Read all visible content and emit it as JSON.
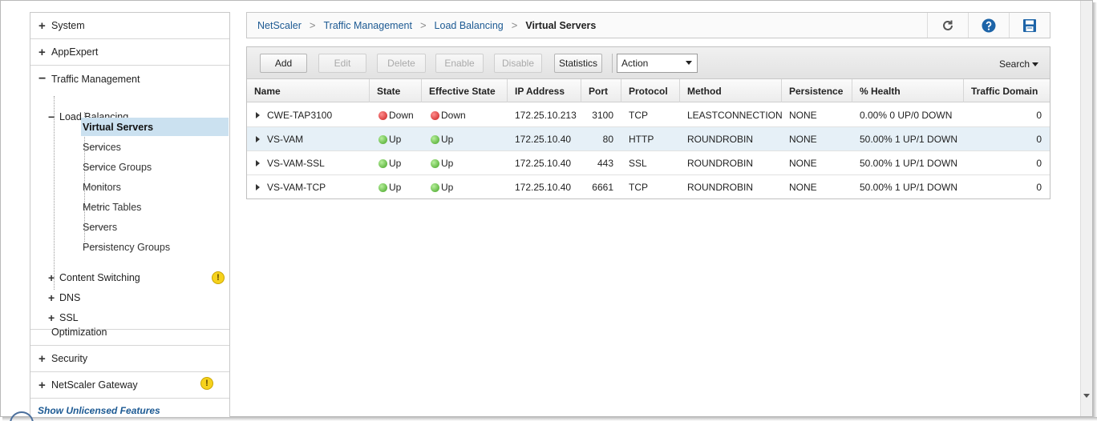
{
  "nav": {
    "top_items": [
      {
        "label": "System",
        "expander": "+"
      },
      {
        "label": "AppExpert",
        "expander": "+"
      },
      {
        "label": "Traffic Management",
        "expander": "−"
      }
    ],
    "tree": {
      "load_balancing": {
        "label": "Load Balancing",
        "expander": "−"
      },
      "lb_children": [
        "Virtual Servers",
        "Services",
        "Service Groups",
        "Monitors",
        "Metric Tables",
        "Servers",
        "Persistency Groups"
      ],
      "active_child": "Virtual Servers",
      "content_switching": {
        "label": "Content Switching",
        "expander": "+",
        "warning": "!"
      },
      "dns": {
        "label": "DNS",
        "expander": "+"
      },
      "ssl": {
        "label": "SSL",
        "expander": "+"
      }
    },
    "bottom_items": [
      {
        "label": "Optimization",
        "expander": ""
      },
      {
        "label": "Security",
        "expander": "+"
      },
      {
        "label": "NetScaler Gateway",
        "expander": "+",
        "warning": "!"
      }
    ],
    "unlicensed_link": "Show Unlicensed Features"
  },
  "breadcrumb": {
    "items": [
      "NetScaler",
      "Traffic Management",
      "Load Balancing"
    ],
    "current": "Virtual Servers",
    "separator": ">"
  },
  "toolbar_icons": [
    "refresh-icon",
    "help-icon",
    "save-icon"
  ],
  "toolbar": {
    "add": "Add",
    "edit": "Edit",
    "delete": "Delete",
    "enable": "Enable",
    "disable": "Disable",
    "statistics": "Statistics",
    "action_select": "Action",
    "search": "Search"
  },
  "table": {
    "columns": [
      "Name",
      "State",
      "Effective State",
      "IP Address",
      "Port",
      "Protocol",
      "Method",
      "Persistence",
      "% Health",
      "Traffic Domain"
    ],
    "rows": [
      {
        "name": "CWE-TAP3100",
        "state": "Down",
        "effective_state": "Down",
        "ip": "172.25.10.213",
        "port": "3100",
        "protocol": "TCP",
        "method": "LEASTCONNECTION",
        "persistence": "NONE",
        "health": "0.00% 0 UP/0 DOWN",
        "traffic_domain": "0"
      },
      {
        "name": "VS-VAM",
        "state": "Up",
        "effective_state": "Up",
        "ip": "172.25.10.40",
        "port": "80",
        "protocol": "HTTP",
        "method": "ROUNDROBIN",
        "persistence": "NONE",
        "health": "50.00% 1 UP/1 DOWN",
        "traffic_domain": "0"
      },
      {
        "name": "VS-VAM-SSL",
        "state": "Up",
        "effective_state": "Up",
        "ip": "172.25.10.40",
        "port": "443",
        "protocol": "SSL",
        "method": "ROUNDROBIN",
        "persistence": "NONE",
        "health": "50.00% 1 UP/1 DOWN",
        "traffic_domain": "0"
      },
      {
        "name": "VS-VAM-TCP",
        "state": "Up",
        "effective_state": "Up",
        "ip": "172.25.10.40",
        "port": "6661",
        "protocol": "TCP",
        "method": "ROUNDROBIN",
        "persistence": "NONE",
        "health": "50.00% 1 UP/1 DOWN",
        "traffic_domain": "0"
      }
    ],
    "selected_row": 1
  },
  "colors": {
    "link": "#1d5a93",
    "selected_nav": "#cbe1f0",
    "selected_row": "#e6f0f7",
    "state_up": "#43a323",
    "state_down": "#c81e1e",
    "warning": "#f6d21c"
  }
}
